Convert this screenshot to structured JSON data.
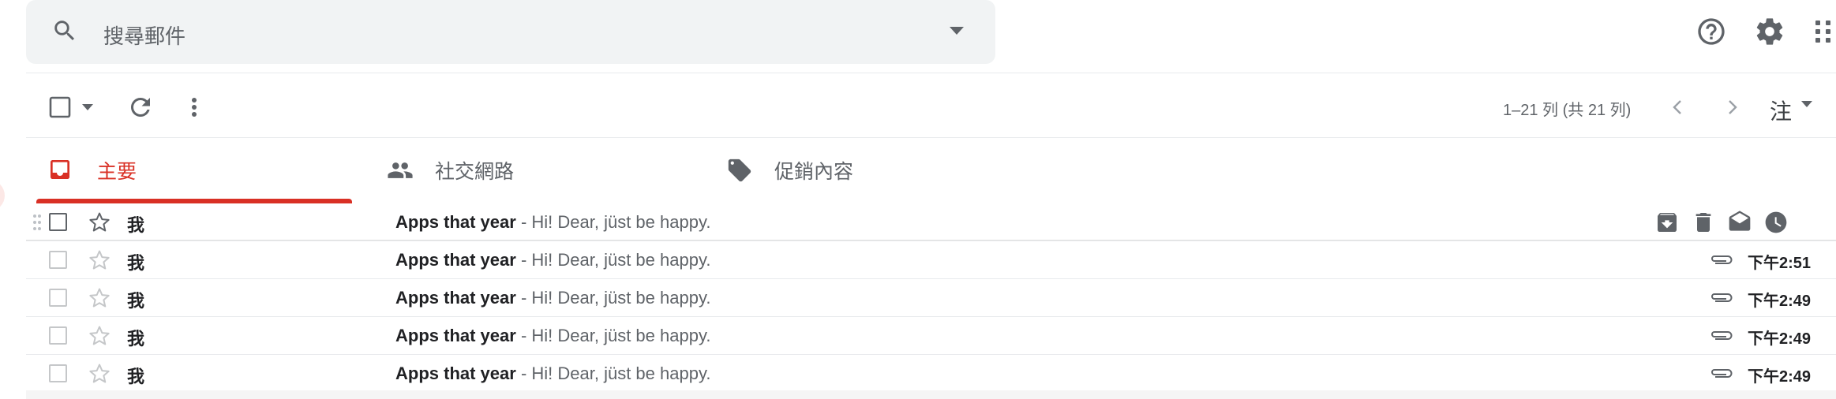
{
  "search": {
    "placeholder": "搜尋郵件"
  },
  "toolbar": {
    "pagination": "1–21 列 (共 21 列)",
    "input_tool": "注"
  },
  "tabs": [
    {
      "label": "主要"
    },
    {
      "label": "社交網路"
    },
    {
      "label": "促銷內容"
    }
  ],
  "emails": [
    {
      "sender": "我",
      "subject": "Apps that year",
      "separator": " - ",
      "snippet": "Hi! Dear, jüst be happy.",
      "time": ""
    },
    {
      "sender": "我",
      "subject": "Apps that year",
      "separator": " - ",
      "snippet": "Hi! Dear, jüst be happy.",
      "time": "下午2:51"
    },
    {
      "sender": "我",
      "subject": "Apps that year",
      "separator": " - ",
      "snippet": "Hi! Dear, jüst be happy.",
      "time": "下午2:49"
    },
    {
      "sender": "我",
      "subject": "Apps that year",
      "separator": " - ",
      "snippet": "Hi! Dear, jüst be happy.",
      "time": "下午2:49"
    },
    {
      "sender": "我",
      "subject": "Apps that year",
      "separator": " - ",
      "snippet": "Hi! Dear, jüst be happy.",
      "time": "下午2:49"
    }
  ],
  "colors": {
    "accent": "#d93025",
    "icon": "#5f6368",
    "search_bg": "#f1f3f4"
  },
  "icons": [
    "search-icon",
    "dropdown-caret-icon",
    "help-icon",
    "settings-gear-icon",
    "apps-grid-icon",
    "refresh-icon",
    "more-vert-icon",
    "chevron-left-icon",
    "chevron-right-icon",
    "inbox-icon",
    "people-icon",
    "tag-icon",
    "drag-handle-icon",
    "star-icon",
    "archive-icon",
    "trash-icon",
    "mark-read-icon",
    "snooze-icon",
    "attachment-icon"
  ]
}
